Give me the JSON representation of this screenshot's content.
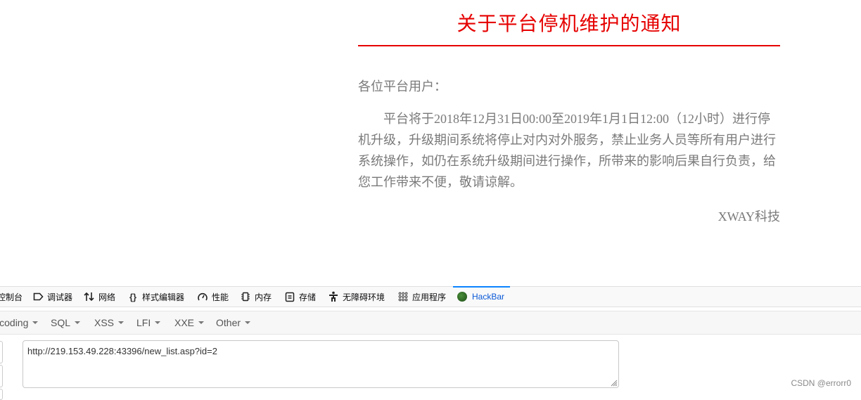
{
  "notice": {
    "title": "关于平台停机维护的通知",
    "greeting": "各位平台用户：",
    "paragraph": "平台将于2018年12月31日00:00至2019年1月1日12:00（12小时）进行停机升级，升级期间系统将停止对内对外服务，禁止业务人员等所有用户进行系统操作，如仍在系统升级期间进行操作，所带来的影响后果自行负责，给您工作带来不便，敬请谅解。",
    "signature": "XWAY科技",
    "accent_color": "#e60000"
  },
  "devtools": {
    "tabs": [
      {
        "label": "控制台",
        "icon": "console-icon"
      },
      {
        "label": "调试器",
        "icon": "debugger-icon"
      },
      {
        "label": "网络",
        "icon": "network-arrows-icon"
      },
      {
        "label": "样式编辑器",
        "icon": "braces-icon"
      },
      {
        "label": "性能",
        "icon": "gauge-icon"
      },
      {
        "label": "内存",
        "icon": "memory-chip-icon"
      },
      {
        "label": "存储",
        "icon": "storage-icon"
      },
      {
        "label": "无障碍环境",
        "icon": "accessibility-icon"
      },
      {
        "label": "应用程序",
        "icon": "apps-grid-icon"
      },
      {
        "label": "HackBar",
        "icon": "hackbar-logo-icon",
        "active": true
      }
    ]
  },
  "hackbar": {
    "menus": [
      "Encoding",
      "SQL",
      "XSS",
      "LFI",
      "XXE",
      "Other"
    ],
    "url_value": "http://219.153.49.228:43396/new_list.asp?id=2"
  },
  "watermark": "CSDN @errorr0"
}
